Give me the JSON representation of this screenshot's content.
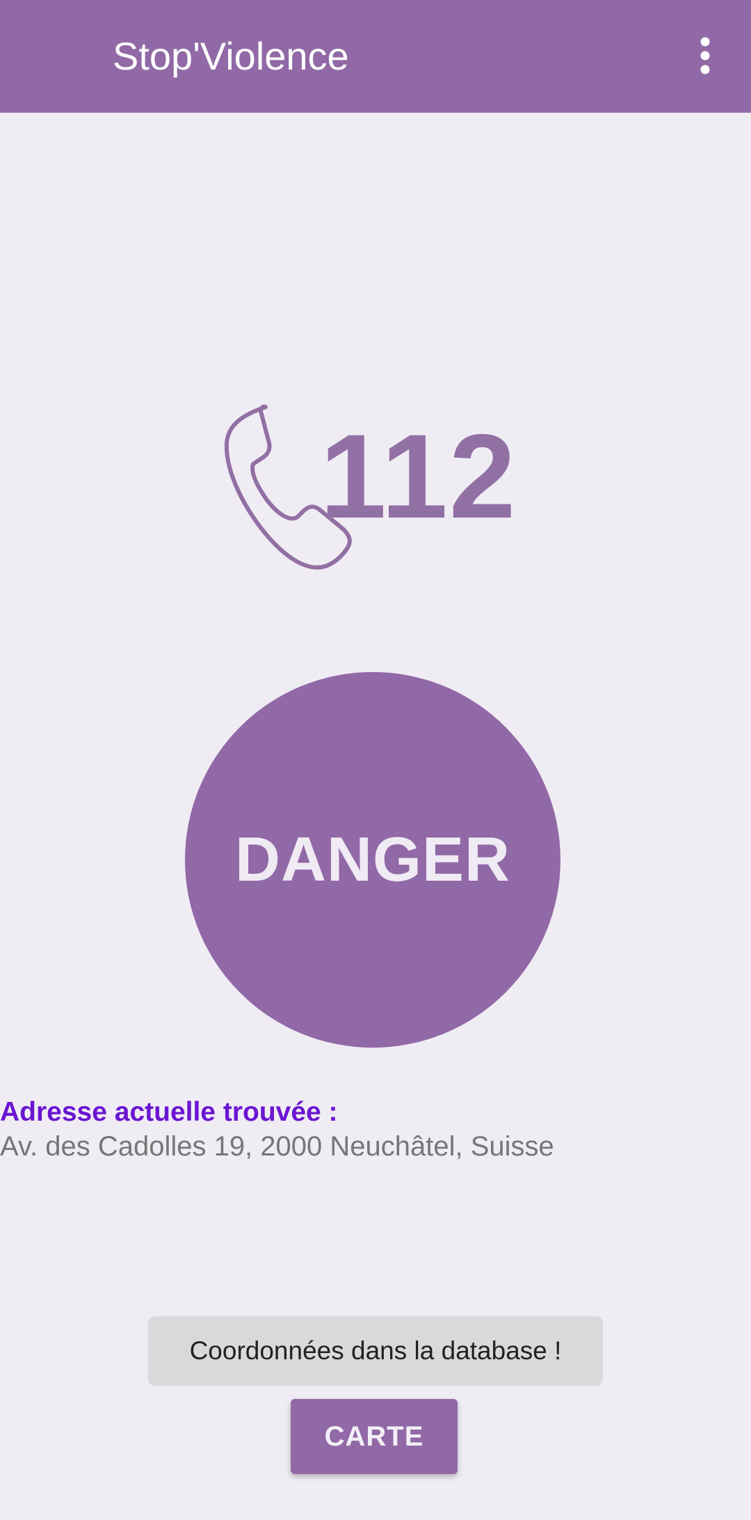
{
  "app_bar": {
    "title": "Stop'Violence",
    "menu_icon": "more-vert-icon",
    "background_color": "#9169a6"
  },
  "emergency": {
    "icon": "phone-icon",
    "number": "112",
    "color": "#9170a4"
  },
  "danger_button": {
    "label": "DANGER",
    "color": "#9169a6"
  },
  "address": {
    "heading": "Adresse actuelle trouvée :",
    "value": "Av. des Cadolles 19, 2000 Neuchâtel, Suisse",
    "heading_color": "#6a15d1"
  },
  "toast": {
    "message": "Coordonnées dans la database !"
  },
  "map_button": {
    "label": "CARTE"
  }
}
